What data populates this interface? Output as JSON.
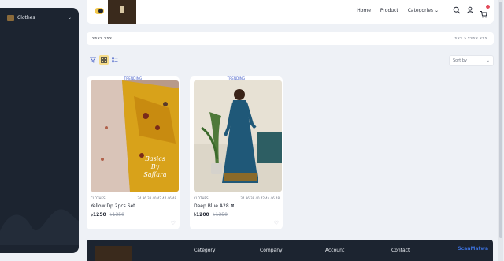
{
  "sidebar": {
    "items": [
      {
        "label": "Clothes"
      }
    ]
  },
  "header": {
    "nav": [
      {
        "label": "Home"
      },
      {
        "label": "Product"
      },
      {
        "label": "Categories"
      }
    ]
  },
  "page": {
    "title": "𝕩𝕩𝕩𝕩 𝕩𝕩𝕩",
    "breadcrumb_home": "𝕩𝕩𝕩",
    "breadcrumb_sep": "»",
    "breadcrumb_current": "𝕩𝕩𝕩𝕩 𝕩𝕩𝕩",
    "sort_placeholder": "Sort by"
  },
  "products": [
    {
      "badge": "TRENDING",
      "category": "CLOTHES",
      "sizes": "34 36 38 40 42 44 46 48",
      "name": "Yellow Dp 2pcs Set",
      "price": "1250",
      "old_price": "1350",
      "currency": "৳",
      "image_text": "Basics By Saffara"
    },
    {
      "badge": "TRENDING",
      "category": "CLOTHES",
      "sizes": "34 36 38 40 42 44 46 48",
      "name": "Deep Blue A28 ⊠",
      "price": "1200",
      "old_price": "1350",
      "currency": "৳"
    }
  ],
  "footer": {
    "columns": [
      {
        "label": "Category"
      },
      {
        "label": "Company"
      },
      {
        "label": "Account"
      },
      {
        "label": "Contact"
      }
    ],
    "brand": "ScanMatwa"
  },
  "colors": {
    "sidebar_bg": "#1c2430",
    "accent": "#f3c84b",
    "badge_red": "#e34b5b",
    "trending_blue": "#3b56c4"
  }
}
